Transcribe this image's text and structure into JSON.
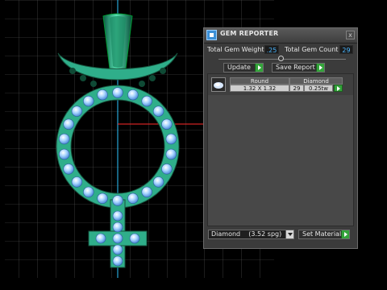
{
  "panel": {
    "title": "GEM REPORTER",
    "close_label": "x",
    "total_weight_label": "Total Gem Weight",
    "total_weight_value": ".25",
    "total_count_label": "Total Gem Count",
    "total_count_value": "29",
    "update_label": "Update",
    "save_report_label": "Save Report",
    "gem_list": {
      "headers": [
        "Round",
        "Diamond"
      ],
      "rows": [
        {
          "size": "1.32 X 1.32",
          "count": "29",
          "weight": "0.25tw"
        }
      ]
    },
    "material_select": {
      "selected": "Diamond    (3.52 spg)"
    },
    "set_material_label": "Set Material"
  },
  "colors": {
    "model": "#2fae8a",
    "gem": "#a9d6ff",
    "accent": "#33a33a",
    "value_text": "#4bb6ff"
  },
  "icons": [
    "gem-reporter-icon",
    "close-icon",
    "go-arrow-icon",
    "gem-thumbnail-icon",
    "chevron-down-icon"
  ]
}
